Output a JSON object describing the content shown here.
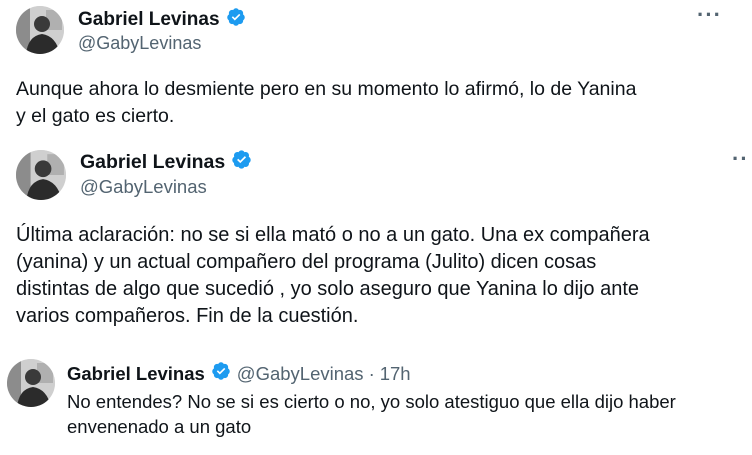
{
  "tweets": [
    {
      "name": "Gabriel Levinas",
      "handle": "@GabyLevinas",
      "text": "Aunque ahora lo desmiente pero en su momento lo afirmó, lo de Yanina\ny el gato es cierto."
    },
    {
      "name": "Gabriel Levinas",
      "handle": "@GabyLevinas",
      "text": "Última aclaración: no se si ella mató o no a un gato. Una ex compañera\n(yanina) y un actual compañero del programa (Julito)  dicen cosas\ndistintas de algo que sucedió , yo solo aseguro que Yanina lo dijo ante\nvarios compañeros. Fin de la cuestión."
    },
    {
      "name": "Gabriel Levinas",
      "handle": "@GabyLevinas",
      "separator": "·",
      "time": "17h",
      "text": "No entendes? No se si es cierto o no, yo solo atestiguo que ella dijo haber\nenvenenado a un gato"
    }
  ],
  "icons": {
    "verified": "verified-badge-icon",
    "more": "more-options-icon",
    "verified_color": "#1d9bf0"
  }
}
